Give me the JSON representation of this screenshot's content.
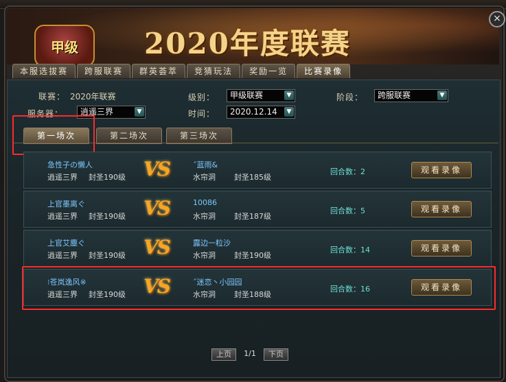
{
  "banner": {
    "logo_text": "甲级",
    "title": "2020年度联赛"
  },
  "close_symbol": "×",
  "tabs": [
    "本服选拔赛",
    "跨服联赛",
    "群英荟萃",
    "竞猜玩法",
    "奖励一览",
    "比赛录像"
  ],
  "active_tab": "比赛录像",
  "filters": {
    "league_label": "联赛：",
    "league_value": "2020年联赛",
    "level_label": "级别：",
    "level_value": "甲级联赛",
    "stage_label": "阶段：",
    "stage_value": "跨服联赛",
    "server_label": "服务器：",
    "server_value": "逍遥三界",
    "time_label": "时间：",
    "time_value": "2020.12.14",
    "dropdown_arrow": "▼"
  },
  "rounds": [
    "第一场次",
    "第二场次",
    "第三场次"
  ],
  "active_round": "第一场次",
  "matches": [
    {
      "p1_name": "急性子の懒人",
      "p1_server": "逍遥三界",
      "p1_rank": "封圣190级",
      "vs": "VS",
      "p2_name": "˝蓝雨&",
      "p2_server": "水帘洞",
      "p2_rank": "封圣185级",
      "rounds_label": "回合数：2",
      "watch": "观看录像"
    },
    {
      "p1_name": "上官墨离ぐ",
      "p1_server": "逍遥三界",
      "p1_rank": "封圣190级",
      "vs": "VS",
      "p2_name": "10086",
      "p2_server": "水帘洞",
      "p2_rank": "封圣187级",
      "rounds_label": "回合数：5",
      "watch": "观看录像"
    },
    {
      "p1_name": "上官艾塵ぐ",
      "p1_server": "逍遥三界",
      "p1_rank": "封圣190级",
      "vs": "VS",
      "p2_name": "露边一粒沙",
      "p2_server": "水帘洞",
      "p2_rank": "封圣190级",
      "rounds_label": "回合数：14",
      "watch": "观看录像"
    },
    {
      "p1_name": "⁝苍岚逸风※",
      "p1_server": "逍遥三界",
      "p1_rank": "封圣190级",
      "vs": "VS",
      "p2_name": "˝迷恋丶小园园",
      "p2_server": "水帘洞",
      "p2_rank": "封圣188级",
      "rounds_label": "回合数：16",
      "watch": "观看录像"
    }
  ],
  "pager": {
    "prev": "上页",
    "page": "1/1",
    "next": "下页"
  },
  "colors": {
    "highlight": "#ff2a2a",
    "player_name": "#7ec7ff",
    "rounds_text": "#6fe0d6",
    "vs": "#f6a623"
  }
}
